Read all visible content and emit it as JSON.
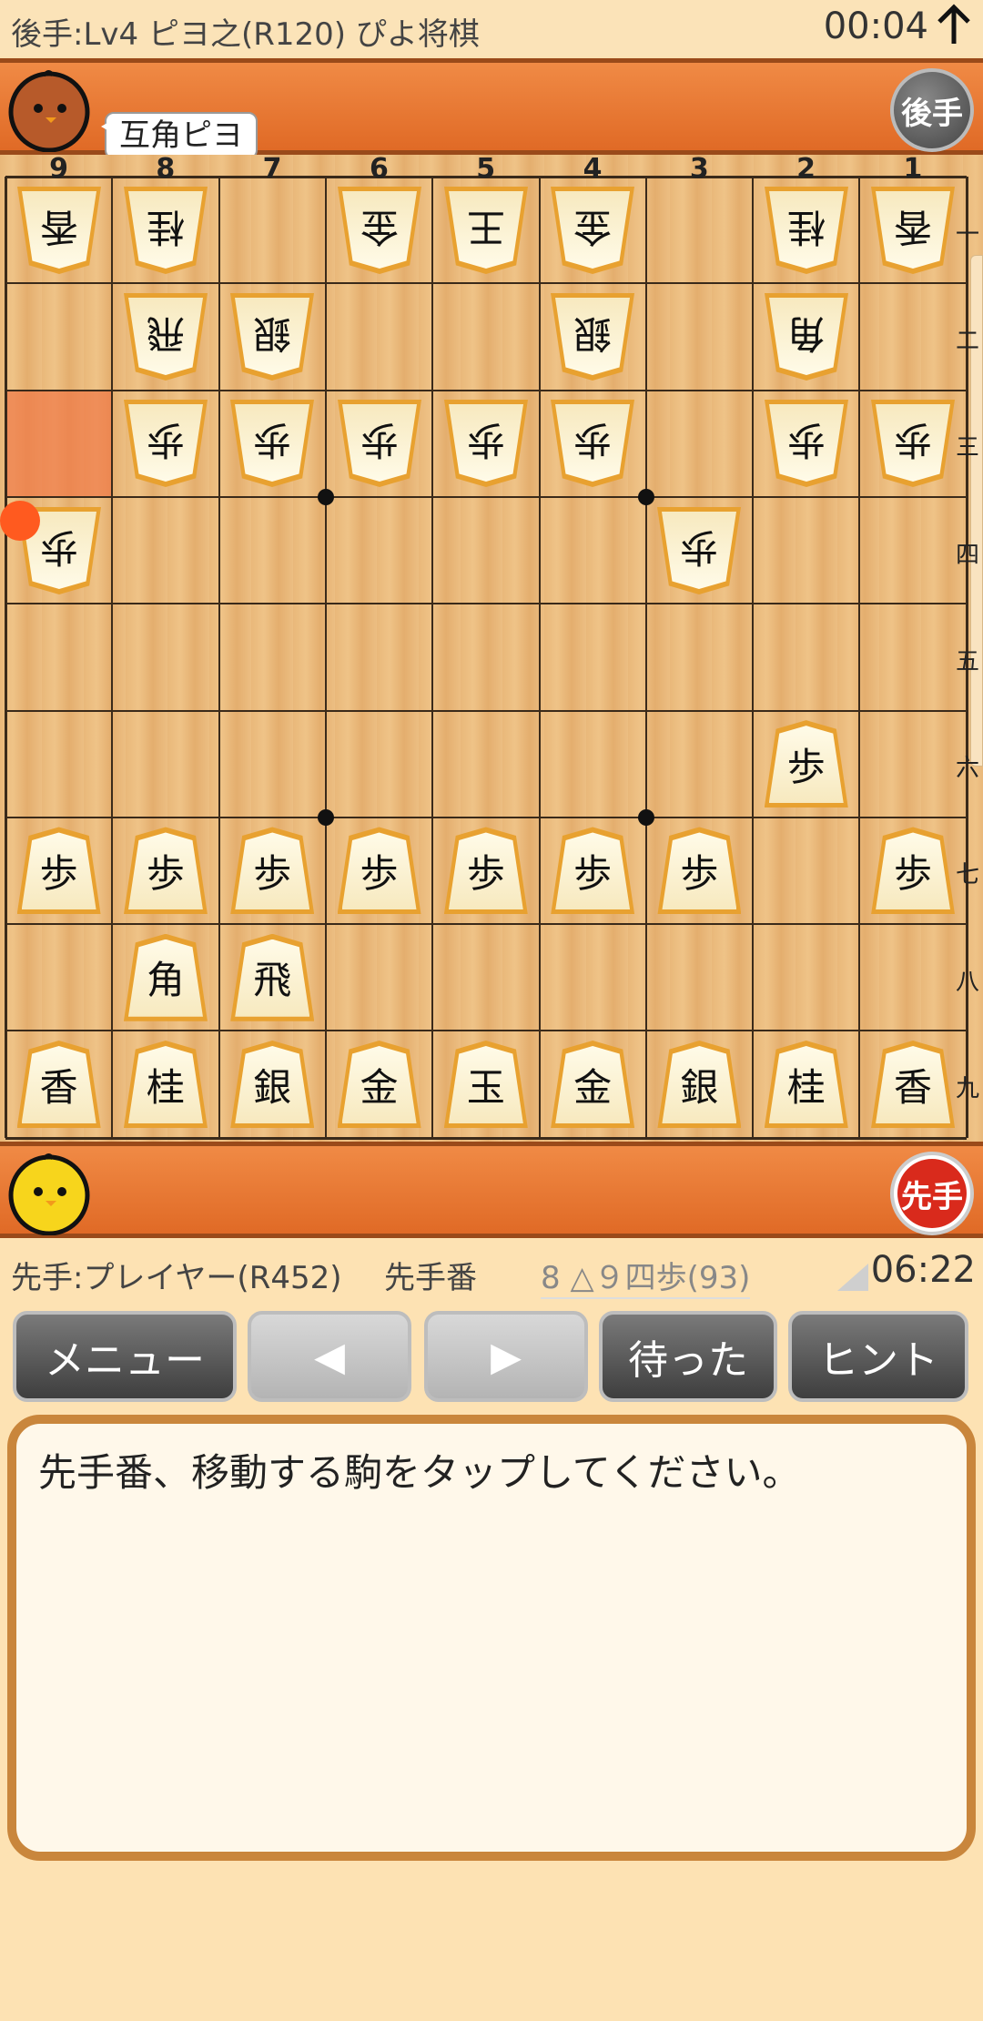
{
  "top": {
    "title": "後手:Lv4 ピヨ之(R120)  ぴよ将棋",
    "clock": "00:04",
    "arrow_icon": "arrow-up-icon"
  },
  "gote": {
    "speech": "互角ピヨ",
    "badge": "後手",
    "avatar": "brown-chick-avatar"
  },
  "sente": {
    "badge": "先手",
    "avatar": "yellow-chick-avatar"
  },
  "board": {
    "files": [
      "9",
      "8",
      "7",
      "6",
      "5",
      "4",
      "3",
      "2",
      "1"
    ],
    "ranks": [
      "一",
      "二",
      "三",
      "四",
      "五",
      "六",
      "七",
      "八",
      "九"
    ],
    "highlight_square": {
      "file": 9,
      "rank": 3
    },
    "last_move_marker": {
      "file": 9,
      "rank": 4
    },
    "pieces": [
      {
        "side": "gote",
        "file": 9,
        "rank": 1,
        "label": "香"
      },
      {
        "side": "gote",
        "file": 8,
        "rank": 1,
        "label": "桂"
      },
      {
        "side": "gote",
        "file": 6,
        "rank": 1,
        "label": "金"
      },
      {
        "side": "gote",
        "file": 5,
        "rank": 1,
        "label": "王"
      },
      {
        "side": "gote",
        "file": 4,
        "rank": 1,
        "label": "金"
      },
      {
        "side": "gote",
        "file": 2,
        "rank": 1,
        "label": "桂"
      },
      {
        "side": "gote",
        "file": 1,
        "rank": 1,
        "label": "香"
      },
      {
        "side": "gote",
        "file": 8,
        "rank": 2,
        "label": "飛"
      },
      {
        "side": "gote",
        "file": 7,
        "rank": 2,
        "label": "銀"
      },
      {
        "side": "gote",
        "file": 4,
        "rank": 2,
        "label": "銀"
      },
      {
        "side": "gote",
        "file": 2,
        "rank": 2,
        "label": "角"
      },
      {
        "side": "gote",
        "file": 8,
        "rank": 3,
        "label": "歩"
      },
      {
        "side": "gote",
        "file": 7,
        "rank": 3,
        "label": "歩"
      },
      {
        "side": "gote",
        "file": 6,
        "rank": 3,
        "label": "歩"
      },
      {
        "side": "gote",
        "file": 5,
        "rank": 3,
        "label": "歩"
      },
      {
        "side": "gote",
        "file": 4,
        "rank": 3,
        "label": "歩"
      },
      {
        "side": "gote",
        "file": 2,
        "rank": 3,
        "label": "歩"
      },
      {
        "side": "gote",
        "file": 1,
        "rank": 3,
        "label": "歩"
      },
      {
        "side": "gote",
        "file": 9,
        "rank": 4,
        "label": "歩"
      },
      {
        "side": "gote",
        "file": 3,
        "rank": 4,
        "label": "歩"
      },
      {
        "side": "sente",
        "file": 2,
        "rank": 6,
        "label": "歩"
      },
      {
        "side": "sente",
        "file": 9,
        "rank": 7,
        "label": "歩"
      },
      {
        "side": "sente",
        "file": 8,
        "rank": 7,
        "label": "歩"
      },
      {
        "side": "sente",
        "file": 7,
        "rank": 7,
        "label": "歩"
      },
      {
        "side": "sente",
        "file": 6,
        "rank": 7,
        "label": "歩"
      },
      {
        "side": "sente",
        "file": 5,
        "rank": 7,
        "label": "歩"
      },
      {
        "side": "sente",
        "file": 4,
        "rank": 7,
        "label": "歩"
      },
      {
        "side": "sente",
        "file": 3,
        "rank": 7,
        "label": "歩"
      },
      {
        "side": "sente",
        "file": 1,
        "rank": 7,
        "label": "歩"
      },
      {
        "side": "sente",
        "file": 8,
        "rank": 8,
        "label": "角"
      },
      {
        "side": "sente",
        "file": 7,
        "rank": 8,
        "label": "飛"
      },
      {
        "side": "sente",
        "file": 9,
        "rank": 9,
        "label": "香"
      },
      {
        "side": "sente",
        "file": 8,
        "rank": 9,
        "label": "桂"
      },
      {
        "side": "sente",
        "file": 7,
        "rank": 9,
        "label": "銀"
      },
      {
        "side": "sente",
        "file": 6,
        "rank": 9,
        "label": "金"
      },
      {
        "side": "sente",
        "file": 5,
        "rank": 9,
        "label": "玉"
      },
      {
        "side": "sente",
        "file": 4,
        "rank": 9,
        "label": "金"
      },
      {
        "side": "sente",
        "file": 3,
        "rank": 9,
        "label": "銀"
      },
      {
        "side": "sente",
        "file": 2,
        "rank": 9,
        "label": "桂"
      },
      {
        "side": "sente",
        "file": 1,
        "rank": 9,
        "label": "香"
      }
    ]
  },
  "info": {
    "player": "先手:プレイヤー(R452)",
    "turn": "先手番",
    "last_move": "8 △９四歩(93)",
    "clock": "06:22"
  },
  "buttons": {
    "menu": "メニュー",
    "prev": "◀",
    "next": "▶",
    "matta": "待った",
    "hint": "ヒント"
  },
  "message": "先手番、移動する駒をタップしてください。",
  "colors": {
    "bar": "#e97a35",
    "board": "#ecbe82",
    "piece_border": "#e8a130",
    "highlight": "#f07846",
    "marker": "#ff5a1f"
  }
}
